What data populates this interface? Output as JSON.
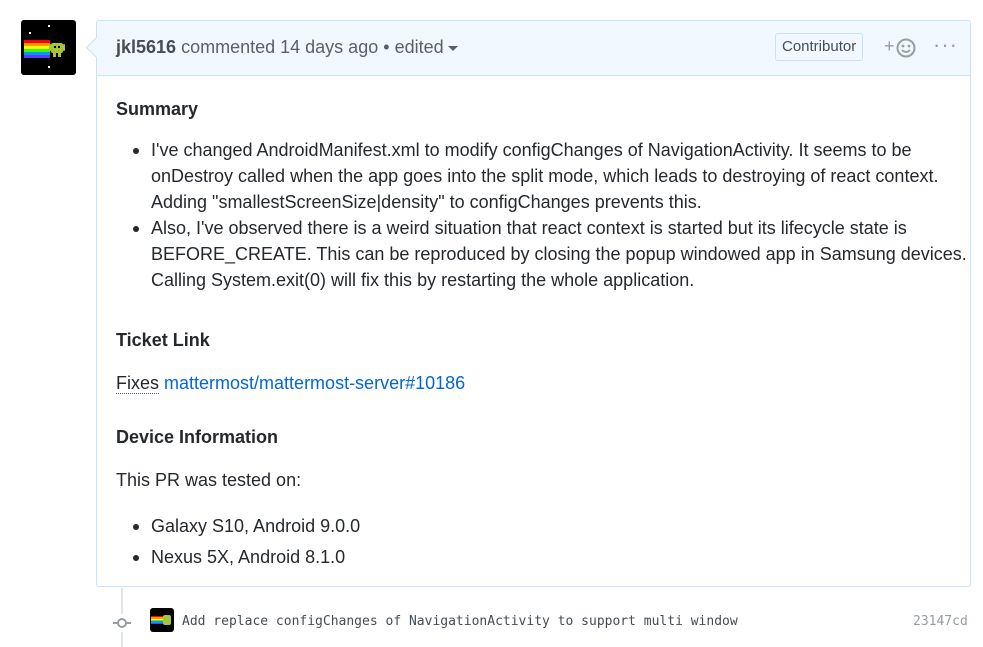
{
  "comment": {
    "author": "jkl5616",
    "action": "commented",
    "time": "14 days ago",
    "separator": "•",
    "edited": "edited",
    "badge": "Contributor",
    "reaction_plus": "+",
    "more_label": "···"
  },
  "body": {
    "summary_heading": "Summary",
    "summary_items": [
      [
        "I've changed AndroidManifest.xml to modify configChanges of NavigationActivity. It seems to be",
        "onDestroy called when the app goes into the split mode, which leads to destroying of react context.",
        "Adding \"smallestScreenSize|density\" to configChanges prevents this."
      ],
      [
        "Also, I've observed there is a weird situation that react context is started but its lifecycle state is",
        "BEFORE_CREATE. This can be reproduced by closing the popup windowed app in Samsung devices.",
        "Calling System.exit(0) will fix this by restarting the whole application."
      ]
    ],
    "ticket_heading": "Ticket Link",
    "fixes_label": "Fixes",
    "fixes_link": "mattermost/mattermost-server#10186",
    "device_heading": "Device Information",
    "tested_on": "This PR was tested on:",
    "devices": [
      "Galaxy S10, Android 9.0.0",
      "Nexus 5X, Android 8.1.0"
    ]
  },
  "commit": {
    "message": "Add replace configChanges of NavigationActivity to support multi window",
    "sha": "23147cd"
  },
  "colors": {
    "header_bg": "#f1f8ff",
    "border": "#c8e1ff",
    "link": "#0366d6",
    "rainbow": [
      "#ff0000",
      "#ff9900",
      "#ffff00",
      "#33ff00",
      "#0099ff",
      "#6633ff"
    ]
  },
  "icons": {
    "avatar": "nyan-android-avatar",
    "reaction": "smiley-icon",
    "more": "kebab-horizontal-icon",
    "commit": "git-commit-icon"
  }
}
